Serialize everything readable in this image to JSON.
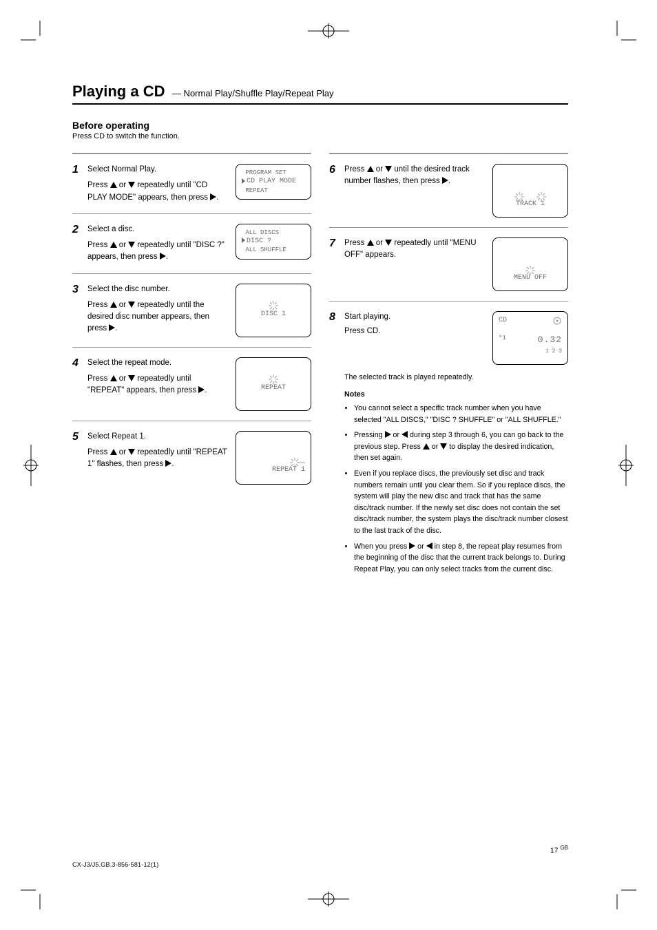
{
  "meta": {
    "page_number_label": "17",
    "section_code_label": "GB",
    "job_line": "CX-J3/J5.GB.3-856-581-12(1)"
  },
  "header": {
    "title": "Playing a CD",
    "subtitle": "— Normal Play/Shuffle Play/Repeat Play",
    "section_label": "Before operating",
    "lead": "Press CD to switch the function."
  },
  "left": {
    "steps": [
      {
        "num": "1",
        "text_a": "Select Normal Play.",
        "text_b_pre": "Press ",
        "text_b_or": " or ",
        "text_b_post": " repeatedly until \"CD PLAY MODE\" appears, then press ",
        "text_b_end": ".",
        "display": {
          "rows": [
            "PROGRAM SET",
            [
              "cursor",
              "CD PLAY MODE"
            ],
            "REPEAT"
          ]
        }
      },
      {
        "num": "2",
        "text_a": "Select a disc.",
        "text_b_pre": "Press ",
        "text_b_or": " or ",
        "text_b_post": " repeatedly until \"DISC ?\" appears, then press ",
        "text_b_end": ".",
        "display": {
          "rows": [
            "ALL DISCS",
            [
              "cursor",
              "DISC ?"
            ],
            "ALL SHUFFLE"
          ]
        }
      },
      {
        "num": "3",
        "text_a": "Select the disc number.",
        "text_b_pre": "Press ",
        "text_b_or": " or ",
        "text_b_post": " repeatedly until the desired disc number appears, then press ",
        "text_b_end": ".",
        "display": {
          "type": "one-line-center",
          "line": "DISC 1",
          "annot_right": "sun"
        }
      },
      {
        "num": "4",
        "text_a": "Select the repeat mode.",
        "text_b_pre": "Press ",
        "text_b_or": " or ",
        "text_b_post": " repeatedly until \"REPEAT\" appears, then press ",
        "text_b_end": ".",
        "display": {
          "type": "one-line-center",
          "line": "REPEAT",
          "annot_right": "sun"
        }
      },
      {
        "num": "5",
        "text_a": "Select Repeat 1.",
        "text_b_pre": "Press ",
        "text_b_or": " or ",
        "text_b_post": " repeatedly until \"REPEAT 1\" flashes, then press ",
        "text_b_end": ".",
        "display": {
          "type": "one-line-right",
          "line": "REPEAT 1",
          "annot_right": "sun-sun"
        }
      }
    ]
  },
  "right": {
    "steps": [
      {
        "num": "6",
        "text_a_pre": "Press ",
        "text_a_or": " or ",
        "text_a_mid": " until the desired track number flashes, then press ",
        "text_a_end": ".",
        "display": {
          "type": "two-center-suns",
          "line": "TRACK 1"
        }
      },
      {
        "num": "7",
        "text_a_pre": "Press ",
        "text_a_or": " or ",
        "text_a_mid": " repeatedly until \"MENU OFF\" appears.",
        "display": {
          "type": "one-line-center",
          "line": "MENU OFF",
          "annot_right": "sun"
        }
      },
      {
        "num": "8",
        "text_a": "Start playing.",
        "text_b": "Press CD.",
        "display": {
          "type": "cd-disc",
          "line1": "CD",
          "line2_left": "*1",
          "line2_right_time": "0.32",
          "line3_right": "1 2 3"
        },
        "followup": "The selected track is played repeatedly.",
        "notes_h": "Notes",
        "notes": [
          "You cannot select a specific track number when you have selected \"ALL DISCS,\" \"DISC ? SHUFFLE\" or \"ALL SHUFFLE.\""
        ],
        "note2_pre": "Pressing ",
        "note2_or_a": " or ",
        "note2_mid": " during step 3 through 6, you can go back to the previous step. Press ",
        "note2_or_b": " or ",
        "note2_post": " to display the desired indication, then set again.",
        "note3_pre": "Even if you replace discs, the previously set disc and track numbers remain until you clear them. So if you replace discs, the system will play the new disc and track that has the same disc/track number. If the newly set disc does not contain the set disc/track number, the system plays the disc/track number closest to the last track of the disc.",
        "note4_pre": "When you press ",
        "note4_or": " or ",
        "note4_post": " in step 8, the repeat play resumes from the beginning of the disc that the current track belongs to. During Repeat Play, you can only select tracks from the current disc."
      }
    ]
  }
}
